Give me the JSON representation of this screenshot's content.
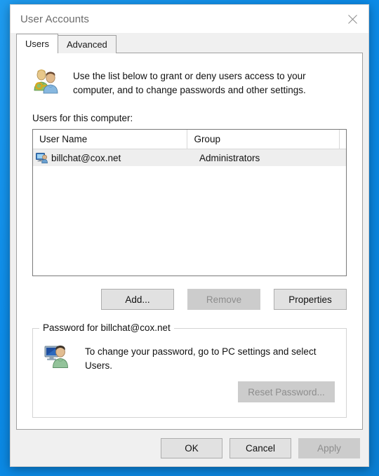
{
  "window": {
    "title": "User Accounts",
    "close_icon": "close-x-icon"
  },
  "tabs": [
    {
      "label": "Users",
      "active": true
    },
    {
      "label": "Advanced",
      "active": false
    }
  ],
  "header": {
    "icon": "users-with-key-icon",
    "line1": "Use the list below to grant or deny users access to your",
    "line2": "computer, and to change passwords and other settings."
  },
  "list": {
    "label": "Users for this computer:",
    "columns": [
      "User Name",
      "Group"
    ],
    "rows": [
      {
        "icon": "user-computer-icon",
        "user_name": "billchat@cox.net",
        "group": "Administrators",
        "selected": true
      }
    ]
  },
  "mid_buttons": [
    {
      "label": "Add...",
      "disabled": false
    },
    {
      "label": "Remove",
      "disabled": true
    },
    {
      "label": "Properties",
      "disabled": false
    }
  ],
  "password_group": {
    "legend": "Password for billchat@cox.net",
    "icon": "user-monitor-icon",
    "line1": "To change your password, go to PC settings and select",
    "line2": "Users.",
    "reset_button": {
      "label": "Reset Password...",
      "disabled": true
    }
  },
  "footer_buttons": [
    {
      "label": "OK",
      "disabled": false
    },
    {
      "label": "Cancel",
      "disabled": false
    },
    {
      "label": "Apply",
      "disabled": true
    }
  ],
  "colors": {
    "desktop_blue": "#0c8ce9",
    "window_bg": "#f0f0f0",
    "tab_page_bg": "#ffffff",
    "selection_bg": "#eeeeee",
    "button_bg": "#e1e1e1",
    "button_disabled_bg": "#cccccc",
    "disabled_text": "#8d8d8d",
    "text": "#111111",
    "title_text": "#6b6b6b"
  }
}
